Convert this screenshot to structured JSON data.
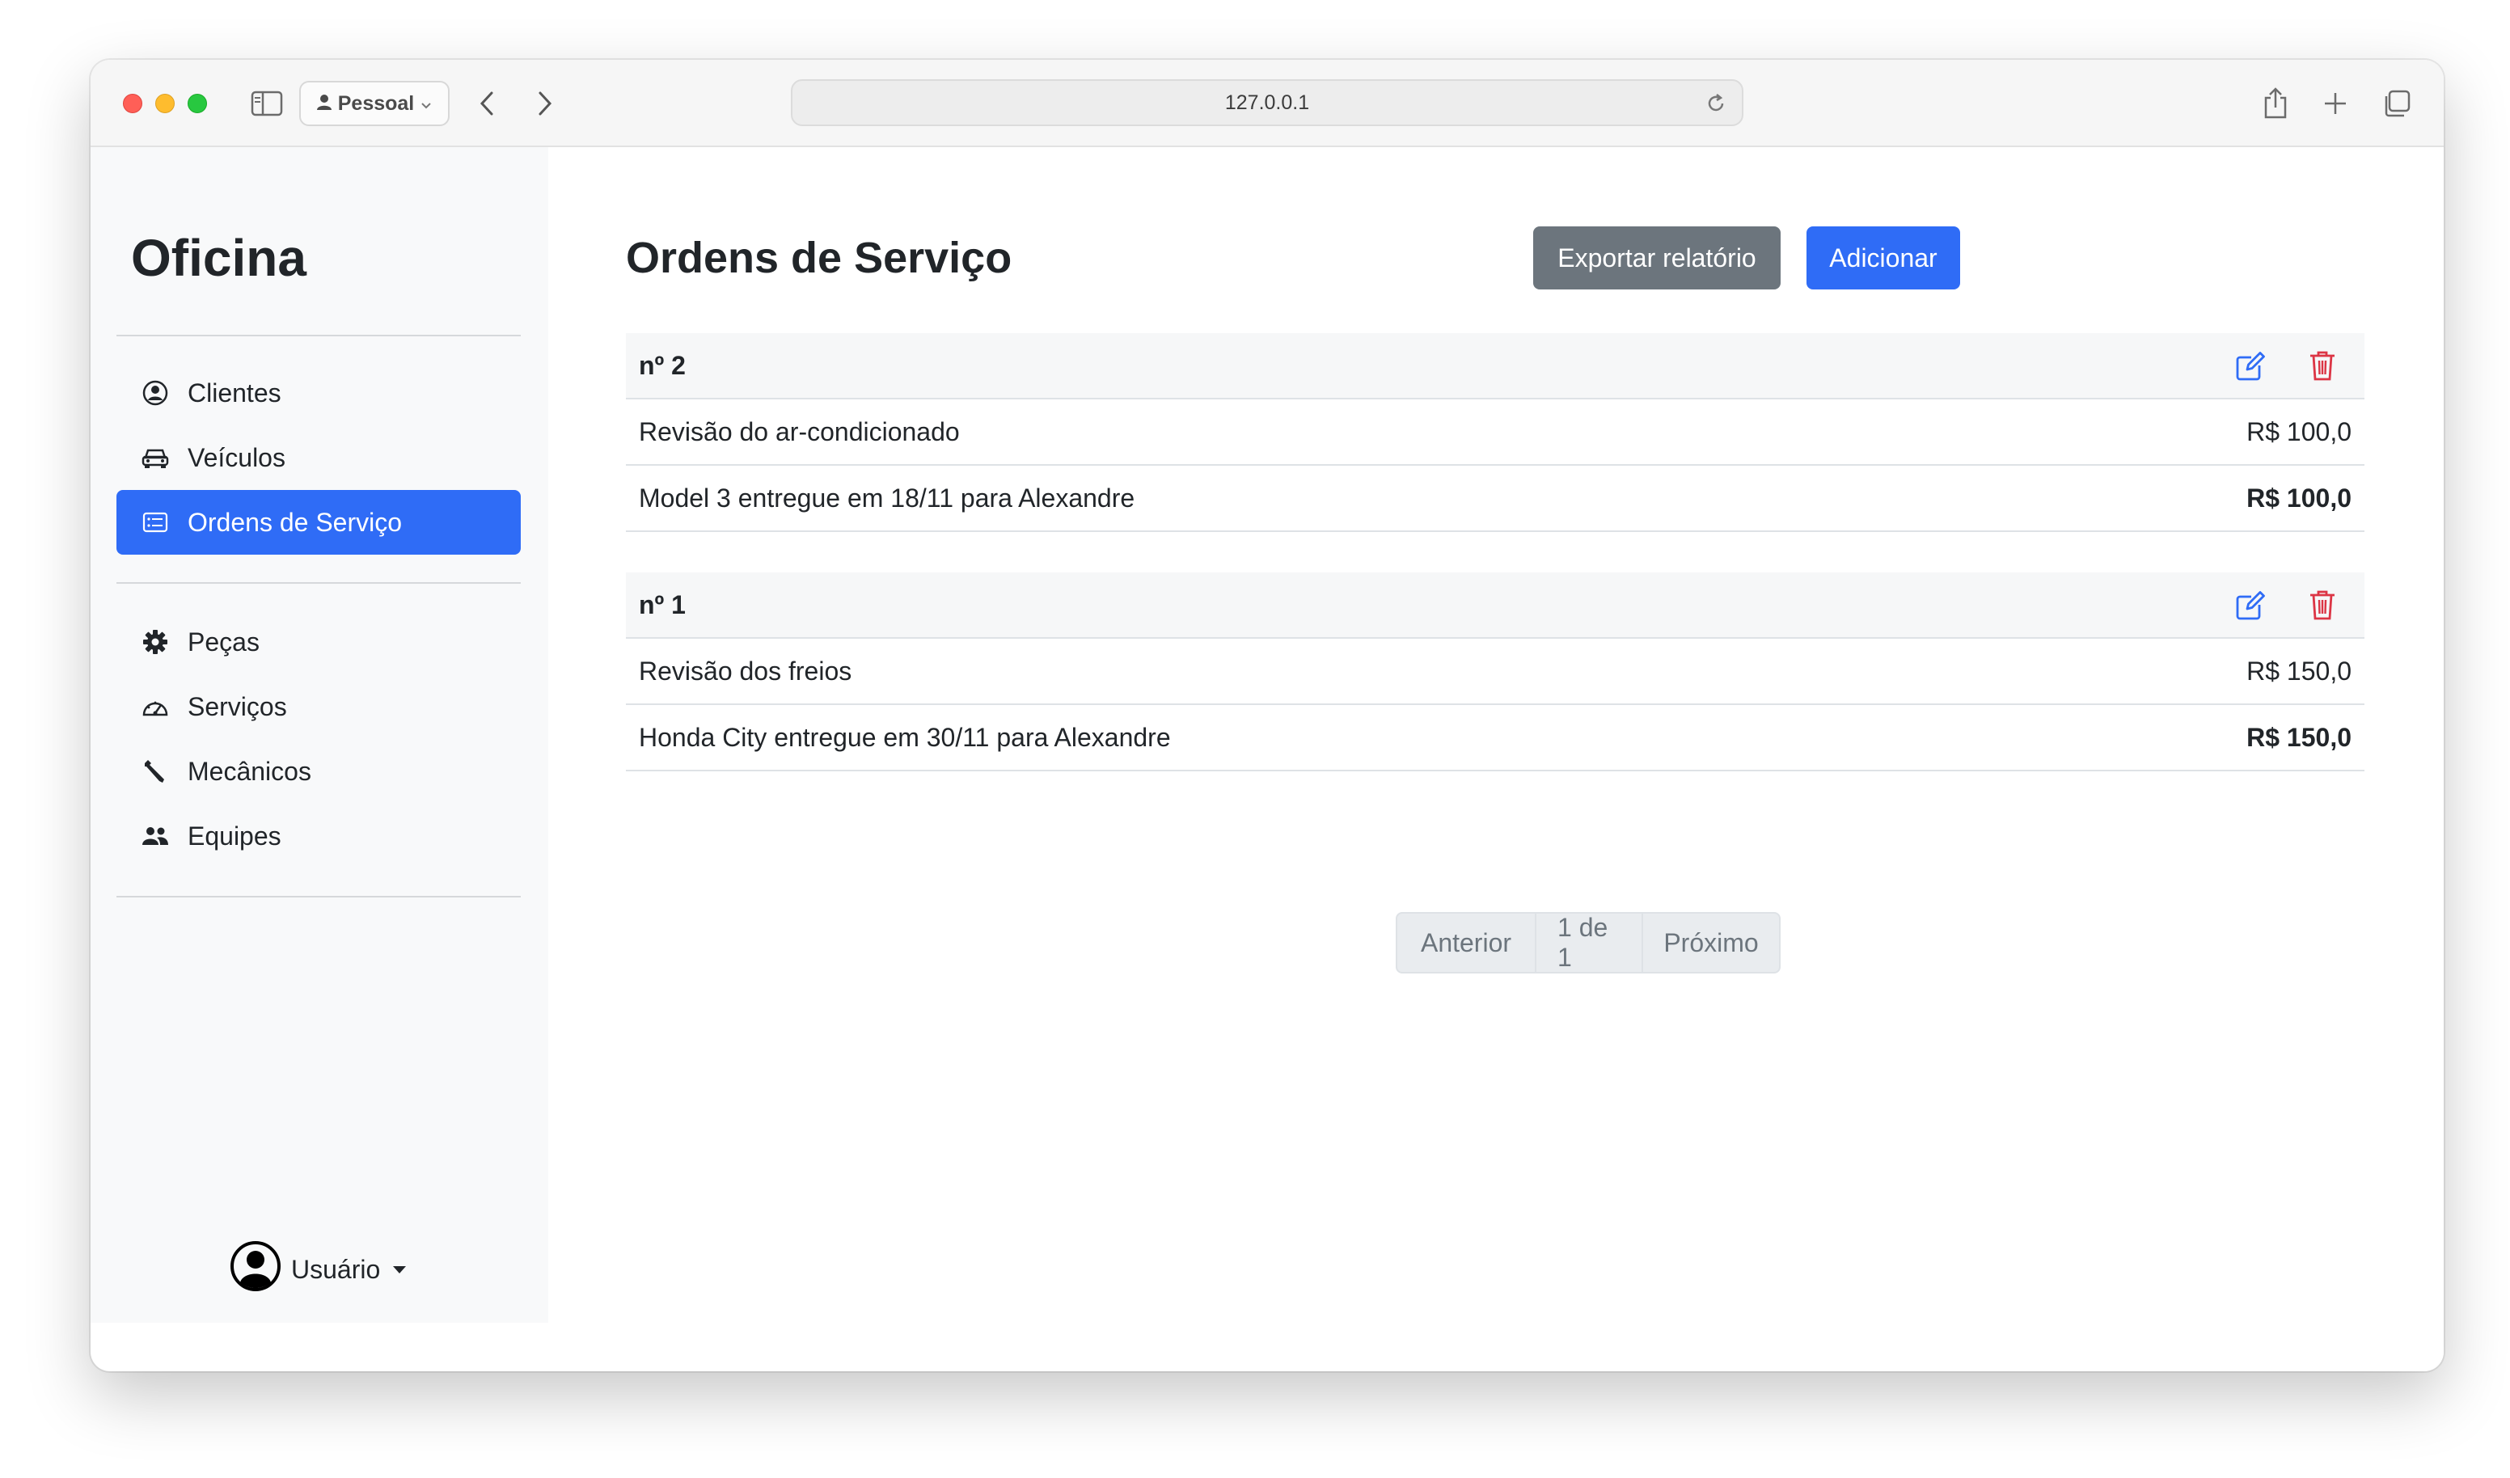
{
  "browser": {
    "profile": "Pessoal",
    "url": "127.0.0.1"
  },
  "sidebar": {
    "brand": "Oficina",
    "items_group1": [
      {
        "label": "Clientes",
        "icon": "person-circle-icon"
      },
      {
        "label": "Veículos",
        "icon": "car-icon"
      },
      {
        "label": "Ordens de Serviço",
        "icon": "card-list-icon",
        "active": true
      }
    ],
    "items_group2": [
      {
        "label": "Peças",
        "icon": "gear-icon"
      },
      {
        "label": "Serviços",
        "icon": "speedometer-icon"
      },
      {
        "label": "Mecânicos",
        "icon": "wrench-icon"
      },
      {
        "label": "Equipes",
        "icon": "people-icon"
      }
    ],
    "user_label": "Usuário"
  },
  "main": {
    "title": "Ordens de Serviço",
    "export_label": "Exportar relatório",
    "add_label": "Adicionar",
    "orders": [
      {
        "number": "nº 2",
        "service": "Revisão do ar-condicionado",
        "service_price": "R$ 100,0",
        "summary": "Model 3 entregue em 18/11 para Alexandre",
        "total": "R$ 100,0"
      },
      {
        "number": "nº 1",
        "service": "Revisão dos freios",
        "service_price": "R$ 150,0",
        "summary": "Honda City entregue em 30/11 para Alexandre",
        "total": "R$ 150,0"
      }
    ],
    "pagination": {
      "prev": "Anterior",
      "page": "1 de 1",
      "next": "Próximo"
    }
  },
  "colors": {
    "primary": "#2f6cf6",
    "secondary": "#6c757d",
    "danger": "#dc3545",
    "sidebar_bg": "#f8f9fa"
  }
}
